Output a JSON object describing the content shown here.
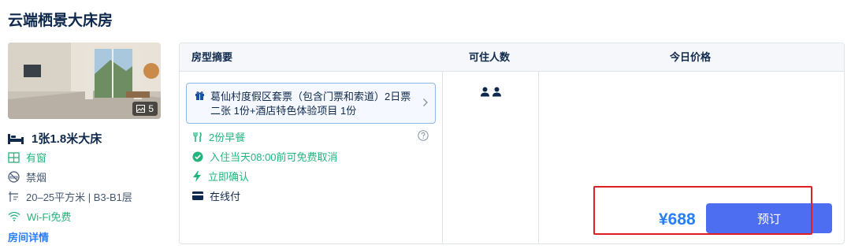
{
  "room": {
    "name": "云端栖景大床房",
    "photo_count": "5",
    "bed": "1张1.8米大床",
    "features": [
      {
        "icon": "window-icon",
        "label": "有窗"
      },
      {
        "icon": "no-smoking-icon",
        "label": "禁烟"
      },
      {
        "icon": "area-icon",
        "label": "20–25平方米 | B3-B1层"
      },
      {
        "icon": "wifi-icon",
        "label": "Wi-Fi免费"
      }
    ],
    "detail_link": "房间详情"
  },
  "table": {
    "headers": {
      "summary": "房型摘要",
      "occupancy": "可住人数",
      "price": "今日价格"
    },
    "package": "葛仙村度假区套票（包含门票和索道）2日票二张 1份+酒店特色体验项目 1份",
    "policies": {
      "breakfast": "2份早餐",
      "cancel": "入住当天08:00前可免费取消",
      "confirm": "立即确认",
      "payment": "在线付"
    },
    "occupancy_count": 2,
    "price": "¥688",
    "book_label": "预订"
  },
  "colors": {
    "accent": "#287dfa",
    "button": "#4e6ef2",
    "green": "#24b47e",
    "highlight": "#e02020"
  }
}
